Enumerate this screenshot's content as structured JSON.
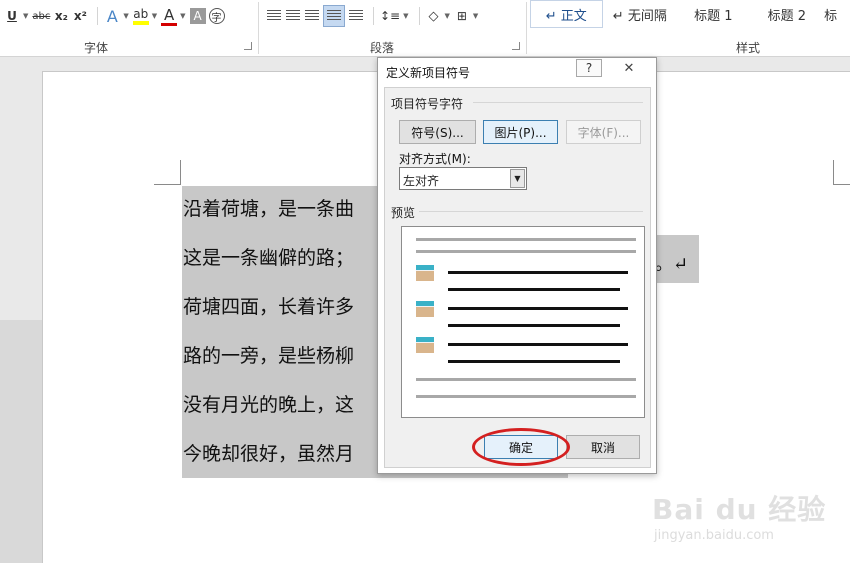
{
  "ribbon": {
    "font_group_label": "字体",
    "paragraph_group_label": "段落",
    "styles_group_label": "样式",
    "font_tools": [
      "U",
      "abc",
      "x₂",
      "x²",
      "A",
      "A",
      "A"
    ],
    "char_circle": "㊫",
    "styles": [
      {
        "label": "↵ 正文",
        "selected": true
      },
      {
        "label": "↵ 无间隔",
        "selected": false
      },
      {
        "label": "标题 1",
        "selected": false
      },
      {
        "label": "标题 2",
        "selected": false
      },
      {
        "label": "标",
        "selected": false
      }
    ]
  },
  "document": {
    "paragraphs": [
      "沿着荷塘，是一条曲",
      "这是一条幽僻的路；",
      "荷塘四面，长着许多",
      "路的一旁，是些杨柳",
      "没有月光的晚上，这",
      "今晚却很好，虽然月"
    ],
    "tail_text": "。↵"
  },
  "dialog": {
    "title": "定义新项目符号",
    "help_label": "?",
    "close_label": "✕",
    "bullet_section_label": "项目符号字符",
    "symbol_button": "符号(S)...",
    "picture_button": "图片(P)...",
    "font_button": "字体(F)...",
    "alignment_label": "对齐方式(M):",
    "alignment_value": "左对齐",
    "preview_label": "预览",
    "ok_button": "确定",
    "cancel_button": "取消"
  },
  "watermark": {
    "brand": "Bai du 经验",
    "url": "jingyan.baidu.com"
  }
}
